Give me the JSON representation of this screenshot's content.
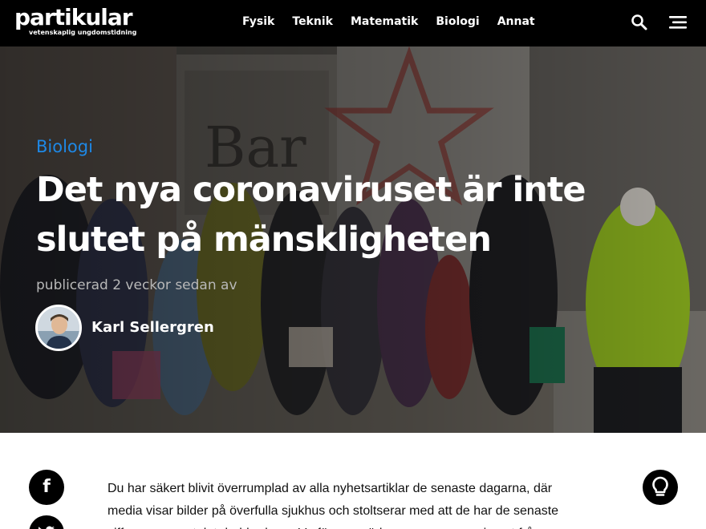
{
  "header": {
    "logo_text": "partikular",
    "logo_tagline": "vetenskaplig ungdomstidning",
    "nav_items": [
      "Fysik",
      "Teknik",
      "Matematik",
      "Biologi",
      "Annat"
    ],
    "search_icon": "search-icon",
    "menu_icon": "hamburger-menu-icon"
  },
  "hero": {
    "category": "Biologi",
    "headline": "Det nya coronaviruset är inte slutet på mänskligheten",
    "published": "publicerad 2 veckor sedan av",
    "author_name": "Karl Sellergren"
  },
  "share": {
    "facebook_icon": "facebook-icon",
    "twitter_icon": "twitter-icon",
    "idea_icon": "lightbulb-icon"
  },
  "article": {
    "lead": "Du har säkert blivit överrumplad av alla nyhetsartiklar de senaste dagarna, där media visar bilder på överfulla sjukhus och stoltserar med att de har de senaste siffrorna om antalet drabbade av. Varför uppmärksammas coronaviruset från"
  },
  "colors": {
    "topbar": "#000000",
    "category_accent": "#1e88e5",
    "text": "#111111"
  }
}
